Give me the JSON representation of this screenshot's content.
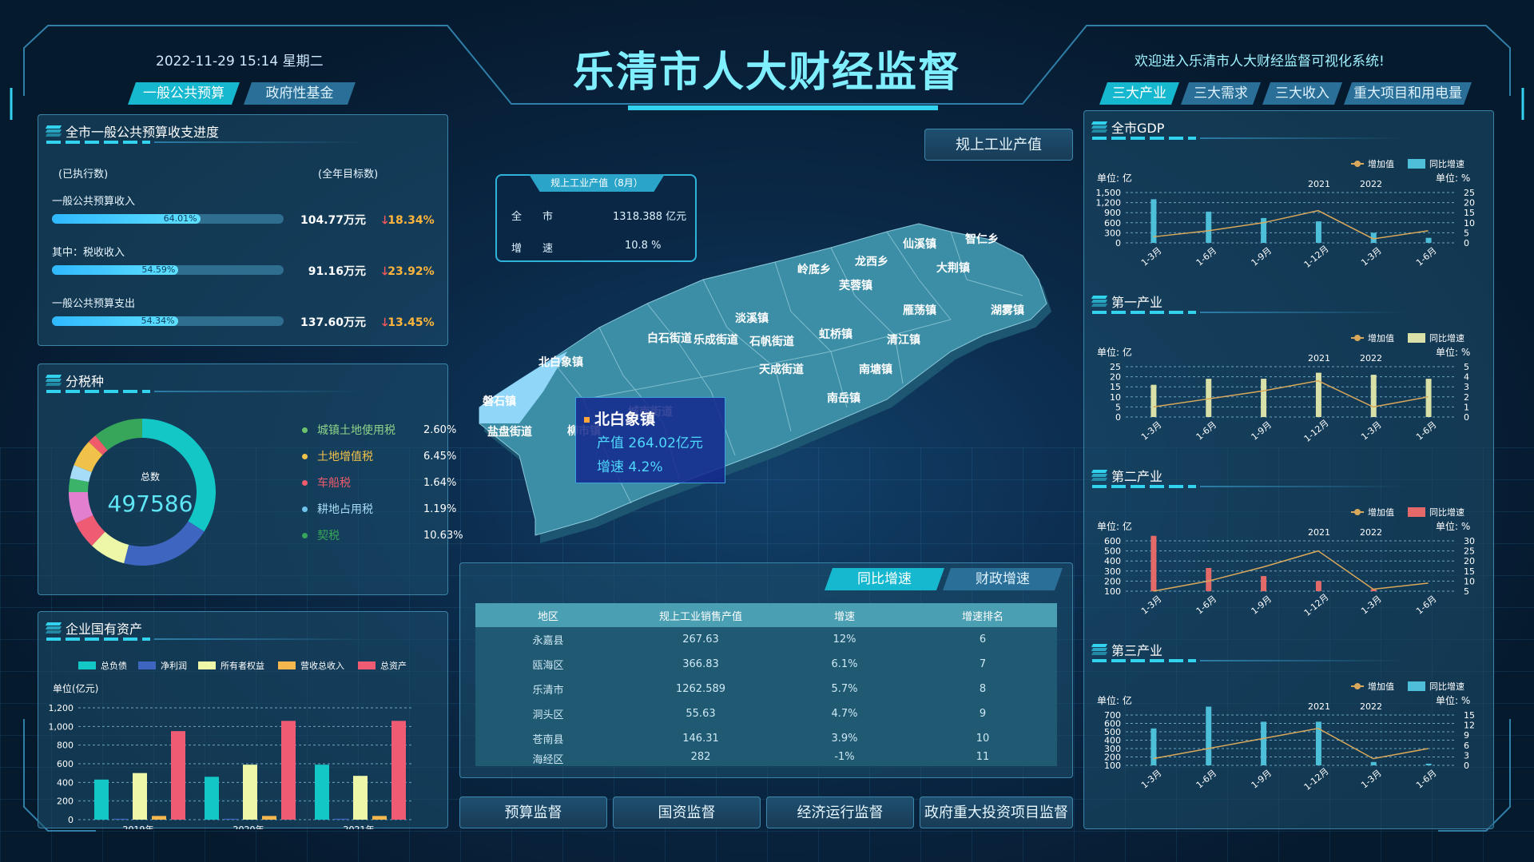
{
  "header": {
    "datetime": "2022-11-29 15:14 星期二",
    "title": "乐清市人大财经监督",
    "welcome": "欢迎进入乐清市人大财经监督可视化系统!"
  },
  "left_tabs": [
    {
      "label": "一般公共预算"
    },
    {
      "label": "政府性基金"
    }
  ],
  "right_tabs": [
    {
      "label": "三大产业"
    },
    {
      "label": "三大需求"
    },
    {
      "label": "三大收入"
    },
    {
      "label": "重大项目和用电量"
    }
  ],
  "budget": {
    "title": "全市一般公共预算收支进度",
    "col_executed": "(已执行数)",
    "col_target": "(全年目标数)",
    "rows": [
      {
        "label": "一般公共预算收入",
        "progress": 64.01,
        "pct_text": "64.01%",
        "amount": "104.77万元",
        "change": "18.34%"
      },
      {
        "label": "其中：税收收入",
        "progress": 54.59,
        "pct_text": "54.59%",
        "amount": "91.16万元",
        "change": "23.92%"
      },
      {
        "label": "一般公共预算支出",
        "progress": 54.34,
        "pct_text": "54.34%",
        "amount": "137.60万元",
        "change": "13.45%"
      }
    ]
  },
  "tax": {
    "title": "分税种",
    "total_label": "总数",
    "total": "497586",
    "items": [
      {
        "name": "城镇土地使用税",
        "pct": "2.60%",
        "color": "#6cc36c",
        "text_color": "#8fd38a"
      },
      {
        "name": "土地增值税",
        "pct": "6.45%",
        "color": "#f0c24a",
        "text_color": "#f0c24a"
      },
      {
        "name": "车船税",
        "pct": "1.64%",
        "color": "#ef5b6b",
        "text_color": "#ef5b6b"
      },
      {
        "name": "耕地占用税",
        "pct": "1.19%",
        "color": "#6fc3ef",
        "text_color": "#a6dcf6"
      },
      {
        "name": "契税",
        "pct": "10.63%",
        "color": "#37a55a",
        "text_color": "#37a55a"
      }
    ]
  },
  "assets": {
    "title": "企业国有资产",
    "unit": "单位(亿元)",
    "legend": [
      {
        "name": "总负债",
        "color": "#14c7c7"
      },
      {
        "name": "净利润",
        "color": "#3e66c0"
      },
      {
        "name": "所有者权益",
        "color": "#eef6a8"
      },
      {
        "name": "营收总收入",
        "color": "#f4b74e"
      },
      {
        "name": "总资产",
        "color": "#ef5b72"
      }
    ]
  },
  "map": {
    "button": "规上工业产值",
    "info_title": "规上工业产值（8月）",
    "info_rows": [
      {
        "k": "全　　市",
        "v": "1318.388 亿元"
      },
      {
        "k": "增　　速",
        "v": "10.8 %"
      }
    ],
    "tooltip": {
      "name": "北白象镇",
      "line1": "产值 264.02亿元",
      "line2": "增速 4.2%"
    },
    "towns": [
      "智仁乡",
      "仙溪镇",
      "龙西乡",
      "岭底乡",
      "大荆镇",
      "芙蓉镇",
      "雁荡镇",
      "湖雾镇",
      "淡溪镇",
      "白石街道",
      "乐成街道",
      "石帆街道",
      "虹桥镇",
      "清江镇",
      "北白象镇",
      "天成街道",
      "南塘镇",
      "磐石镇",
      "盐盘街道",
      "南岳镇",
      "城南街道",
      "柳市镇"
    ]
  },
  "growth_table": {
    "tabs": [
      {
        "label": "同比增速"
      },
      {
        "label": "财政增速"
      }
    ],
    "headers": [
      "地区",
      "规上工业销售产值",
      "增速",
      "增速排名"
    ],
    "rows": [
      [
        "永嘉县",
        "267.63",
        "12%",
        "6"
      ],
      [
        "瓯海区",
        "366.83",
        "6.1%",
        "7"
      ],
      [
        "乐清市",
        "1262.589",
        "5.7%",
        "8"
      ],
      [
        "洞头区",
        "55.63",
        "4.7%",
        "9"
      ],
      [
        "苍南县",
        "146.31",
        "3.9%",
        "10"
      ],
      [
        "海经区",
        "282",
        "-1%",
        "11"
      ]
    ]
  },
  "bottom_buttons": [
    {
      "label": "预算监督"
    },
    {
      "label": "国资监督"
    },
    {
      "label": "经济运行监督"
    },
    {
      "label": "政府重大投资项目监督"
    }
  ],
  "industry": {
    "legend_line": "增加值",
    "legend_bar": "同比增速",
    "unit_left": "单位: 亿",
    "unit_right": "单位: %",
    "year_a": "2021",
    "year_b": "2022",
    "categories": [
      "1-3月",
      "1-6月",
      "1-9月",
      "1-12月",
      "1-3月",
      "1-6月"
    ],
    "charts": [
      {
        "title": "全市GDP",
        "bar_color": "#4dbfd8",
        "left_ticks": [
          "1,500",
          "1,200",
          "900",
          "600",
          "300",
          "0"
        ],
        "right_ticks": [
          "25",
          "20",
          "15",
          "10",
          "5",
          "0"
        ],
        "bars": [
          1300,
          930,
          740,
          640,
          300,
          150
        ],
        "line": [
          3,
          6,
          10,
          16,
          2,
          6
        ]
      },
      {
        "title": "第一产业",
        "bar_color": "#d9e0a8",
        "left_ticks": [
          "25",
          "20",
          "15",
          "10",
          "5",
          "0"
        ],
        "right_ticks": [
          "5",
          "4",
          "3",
          "2",
          "1",
          "0"
        ],
        "bars": [
          16,
          19,
          19,
          22,
          21,
          19
        ],
        "line": [
          1,
          1.8,
          2.6,
          3.6,
          1,
          2
        ]
      },
      {
        "title": "第二产业",
        "bar_color": "#e46a6a",
        "left_ticks": [
          "600",
          "500",
          "400",
          "300",
          "200",
          "100"
        ],
        "right_ticks": [
          "30",
          "25",
          "20",
          "15",
          "10",
          "5"
        ],
        "bars": [
          650,
          330,
          250,
          200,
          120,
          70
        ],
        "line": [
          5,
          10,
          17,
          25,
          6,
          9
        ]
      },
      {
        "title": "第三产业",
        "bar_color": "#4dbfd8",
        "left_ticks": [
          "700",
          "600",
          "500",
          "400",
          "300",
          "200",
          "100"
        ],
        "right_ticks": [
          "15",
          "12",
          "9",
          "6",
          "3",
          "0"
        ],
        "bars": [
          540,
          800,
          620,
          620,
          140,
          120
        ],
        "line": [
          2,
          5,
          8,
          11,
          2,
          5
        ]
      }
    ]
  },
  "colors": {
    "accent": "#32d3ee",
    "panel": "#1e506e",
    "line": "#d9a85a",
    "down": "#ff5a5a",
    "highlight": "#9fe3ff"
  }
}
